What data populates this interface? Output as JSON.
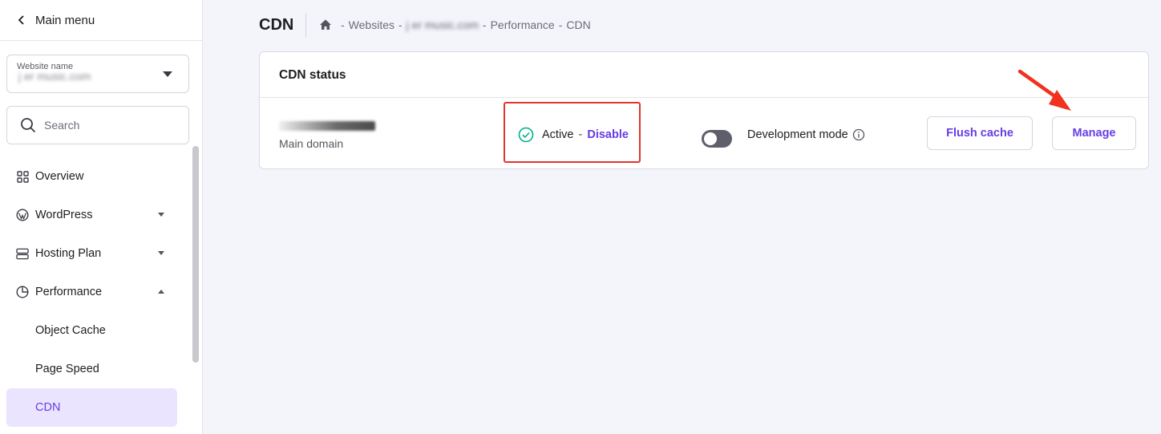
{
  "sidebar": {
    "main_menu_label": "Main menu",
    "website_select": {
      "label": "Website name",
      "value": "j  er music.com"
    },
    "search_placeholder": "Search",
    "nav": [
      {
        "label": "Overview",
        "icon": "grid-icon"
      },
      {
        "label": "WordPress",
        "icon": "wordpress-icon",
        "expanded": false
      },
      {
        "label": "Hosting Plan",
        "icon": "server-icon",
        "expanded": false
      },
      {
        "label": "Performance",
        "icon": "pie-chart-icon",
        "expanded": true
      }
    ],
    "sub_nav": [
      {
        "label": "Object Cache"
      },
      {
        "label": "Page Speed"
      },
      {
        "label": "CDN",
        "active": true
      }
    ]
  },
  "header": {
    "title": "CDN",
    "breadcrumb": {
      "websites": "Websites",
      "site": "j  er music.com",
      "performance": "Performance",
      "current": "CDN",
      "separator": "-"
    }
  },
  "card": {
    "title": "CDN status",
    "domain_caption": "Main domain",
    "status": {
      "state": "Active",
      "action": "Disable"
    },
    "dev_mode": {
      "label": "Development mode",
      "enabled": false
    },
    "buttons": {
      "flush": "Flush cache",
      "manage": "Manage"
    }
  },
  "colors": {
    "accent": "#673de6",
    "active_nav_bg": "#ebe4ff",
    "success": "#00b090",
    "highlight_box": "#e0342c",
    "annotation_arrow": "#f0321e"
  }
}
